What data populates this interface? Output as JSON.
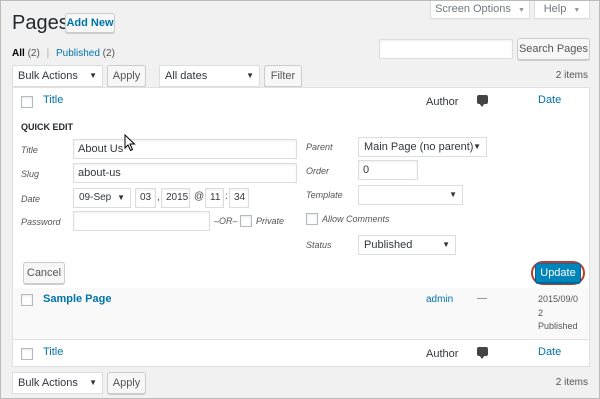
{
  "header": {
    "title": "Pages",
    "add_new_label": "Add New",
    "screen_options_label": "Screen Options",
    "help_label": "Help"
  },
  "subsubsub": {
    "all_label": "All",
    "all_count": "(2)",
    "separator": "|",
    "published_label": "Published",
    "published_count": "(2)"
  },
  "search": {
    "value": "",
    "button_label": "Search Pages"
  },
  "tablenav_top": {
    "bulk_actions": "Bulk Actions",
    "apply_label": "Apply",
    "dates": "All dates",
    "filter_label": "Filter",
    "items_count": "2 items"
  },
  "table": {
    "col_title": "Title",
    "col_author": "Author",
    "col_date": "Date"
  },
  "quick_edit": {
    "heading": "QUICK EDIT",
    "title_label": "Title",
    "title_value": "About Us",
    "slug_label": "Slug",
    "slug_value": "about-us",
    "date_label": "Date",
    "date_month": "09-Sep",
    "date_day": "03",
    "date_year": "2015",
    "date_at": "@",
    "date_hour": "11",
    "date_colon": ":",
    "date_minute": "34",
    "password_label": "Password",
    "password_value": "",
    "or_label": "–OR–",
    "private_label": "Private",
    "parent_label": "Parent",
    "parent_value": "Main Page (no parent)",
    "order_label": "Order",
    "order_value": "0",
    "template_label": "Template",
    "template_value": "",
    "allow_comments_label": "Allow Comments",
    "status_label": "Status",
    "status_value": "Published",
    "cancel_label": "Cancel",
    "update_label": "Update"
  },
  "rows": [
    {
      "title": "Sample Page",
      "author": "admin",
      "comments": "—",
      "date_line1": "2015/09/0",
      "date_line2": "2",
      "date_status": "Published"
    }
  ],
  "tablenav_bottom": {
    "bulk_actions": "Bulk Actions",
    "apply_label": "Apply",
    "items_count": "2 items"
  },
  "colors": {
    "link": "#0073aa",
    "primary_button": "#0085ba",
    "highlight_ring": "#c0392b",
    "background": "#f1f1f1"
  }
}
